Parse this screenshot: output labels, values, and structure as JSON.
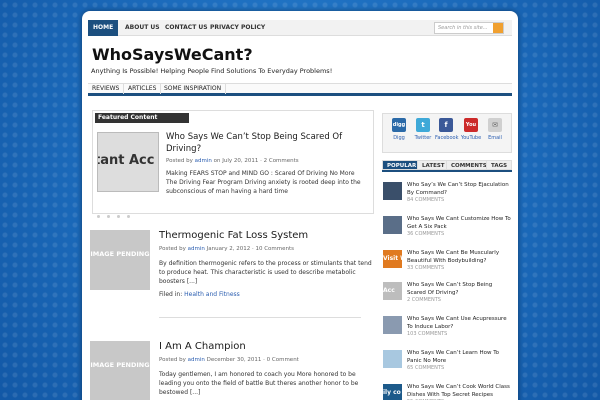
{
  "topnav": {
    "items": [
      "HOME",
      "ABOUT US",
      "CONTACT US",
      "PRIVACY POLICY"
    ],
    "search_placeholder": "Search in this site..."
  },
  "header": {
    "title": "WhoSaysWeCant?",
    "tagline": "Anything Is Possible! Helping People Find Solutions To Everyday Problems!"
  },
  "catnav": {
    "items": [
      "REVIEWS",
      "ARTICLES",
      "SOME INSPIRATION"
    ]
  },
  "featured": {
    "label": "Featured Content",
    "thumb_text": "tant Acc",
    "title": "Who Says We Can’t Stop Being Scared Of Driving?",
    "meta_prefix": "Posted by",
    "author": "admin",
    "meta_on": "on July 20, 2011 ·",
    "comments": "2 Comments",
    "excerpt": "Making FEARS STOP and MIND GO : Scared Of Driving No More   The Driving Fear Program Driving anxiety is rooted deep into the subconscious of man having a hard time"
  },
  "posts": [
    {
      "placeholder": "IMAGE PENDING",
      "title": "Thermogenic Fat Loss System",
      "meta_prefix": "Posted by",
      "author": "admin",
      "date": "January 2, 2012 ·",
      "comments": "10 Comments",
      "excerpt": "By definition thermogenic refers to the process or stimulants that tend to produce heat. This characteristic is used to describe metabolic boosters [...]",
      "filed_prefix": "Filed in:",
      "category": "Health and Fitness"
    },
    {
      "placeholder": "IMAGE PENDING",
      "title": "I Am A Champion",
      "meta_prefix": "Posted by",
      "author": "admin",
      "date": "December 30, 2011 ·",
      "comments": "0 Comment",
      "excerpt": "Today gentlemen, I am honored to coach you More honored to be leading you onto the field of battle But theres another honor to be bestowed [...]"
    }
  ],
  "social": [
    {
      "name": "Digg",
      "icon": "digg-icon",
      "color": "#2b6aa8",
      "glyph": "digg"
    },
    {
      "name": "Twitter",
      "icon": "twitter-icon",
      "color": "#3fa9d8",
      "glyph": "t"
    },
    {
      "name": "Facebook",
      "icon": "facebook-icon",
      "color": "#3b5998",
      "glyph": "f"
    },
    {
      "name": "YouTube",
      "icon": "youtube-icon",
      "color": "#cc2a2a",
      "glyph": "You"
    },
    {
      "name": "Email",
      "icon": "email-icon",
      "color": "#d0d0d0",
      "glyph": "✉"
    }
  ],
  "tabs": [
    "POPULAR",
    "LATEST",
    "COMMENTS",
    "TAGS"
  ],
  "popular": [
    {
      "title": "Who Say’s We Can’t Stop Ejaculation By Command?",
      "comments": "84 COMMENTS",
      "thumb_color": "#3a4f6a"
    },
    {
      "title": "Who Says We Cant Customize How To Get A Six Pack",
      "comments": "36 COMMENTS",
      "thumb_color": "#5a6e88"
    },
    {
      "title": "Who Says We Cant Be Muscularly Beautiful With Bodybuilding?",
      "comments": "33 COMMENTS",
      "thumb_color": "#e07a20",
      "thumb_text": "Visit W"
    },
    {
      "title": "Who Says We Can’t Stop Being Scared Of Driving?",
      "comments": "2 COMMENTS",
      "thumb_color": "#bdbdbd",
      "thumb_text": "Acc"
    },
    {
      "title": "Who Says We Cant Use Acupressure To Induce Labor?",
      "comments": "103 COMMENTS",
      "thumb_color": "#8a9ab0"
    },
    {
      "title": "Who Says We Can’t Learn How To Panic No More",
      "comments": "65 COMMENTS",
      "thumb_color": "#a8c8e0"
    },
    {
      "title": "Who Says We Can’t Cook World Class Dishes With Top Secret Recipes",
      "comments": "55 COMMENTS",
      "thumb_color": "#1d5a8a",
      "thumb_text": "ily co"
    }
  ]
}
